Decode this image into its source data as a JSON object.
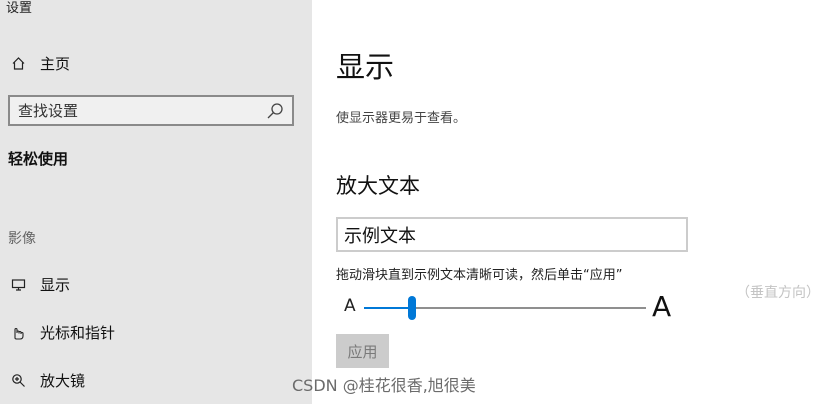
{
  "window": {
    "title": "设置"
  },
  "sidebar": {
    "home": {
      "label": "主页",
      "icon": "home-icon"
    },
    "search": {
      "placeholder": "查找设置",
      "icon": "search-icon"
    },
    "section_heading": "轻松使用",
    "group_label": "影像",
    "items": [
      {
        "label": "显示",
        "icon": "monitor-icon"
      },
      {
        "label": "光标和指针",
        "icon": "cursor-icon"
      },
      {
        "label": "放大镜",
        "icon": "magnifier-icon"
      }
    ]
  },
  "main": {
    "title": "显示",
    "description": "使显示器更易于查看。",
    "enlarge": {
      "heading": "放大文本",
      "sample_text": "示例文本",
      "instruction": "拖动滑块直到示例文本清晰可读，然后单击“应用”",
      "slider": {
        "min_label": "A",
        "max_label": "A",
        "value_fraction": 0.17
      },
      "apply_label": "应用"
    }
  },
  "annotation": {
    "vertical_note": "（垂直方向）"
  },
  "watermark": {
    "text": "CSDN @桂花很香,旭很美"
  },
  "colors": {
    "accent": "#0078d7",
    "sidebar_bg": "#e6e6e6",
    "disabled_button": "#cccccc"
  }
}
